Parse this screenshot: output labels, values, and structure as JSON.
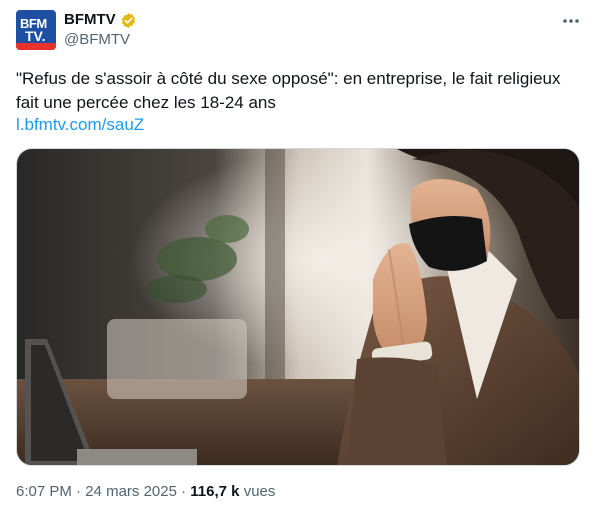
{
  "author": {
    "avatar_line1": "BFM",
    "avatar_line2": "TV.",
    "display_name": "BFMTV",
    "handle": "@BFMTV",
    "verified_color": "#e2b719"
  },
  "tweet": {
    "text": "\"Refus de s'assoir à côté du sexe opposé\": en entreprise, le fait religieux fait une percée chez les 18-24 ans",
    "link": "l.bfmtv.com/sauZ"
  },
  "meta": {
    "time": "6:07 PM",
    "separator1": "·",
    "date": "24 mars 2025",
    "separator2": "·",
    "views_count": "116,7 k",
    "views_label": "vues"
  },
  "icons": {
    "more": "more-horizontal-icon",
    "verified": "verified-badge-icon"
  }
}
